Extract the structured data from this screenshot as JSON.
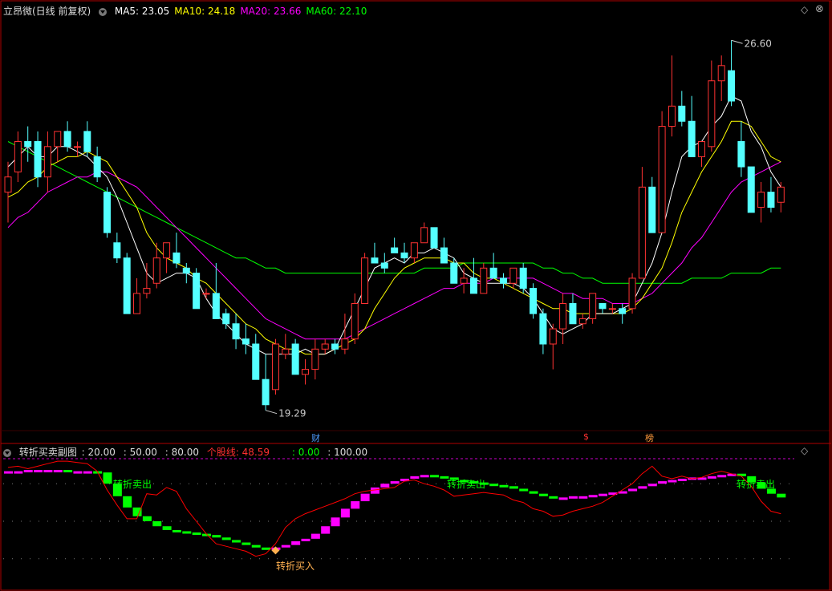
{
  "main_panel": {
    "title": "立昂微(日线 前复权)",
    "ma_legend": [
      {
        "label": "MA5: 23.05",
        "color": "#ffffff"
      },
      {
        "label": "MA10: 24.18",
        "color": "#ffff00"
      },
      {
        "label": "MA20: 23.66",
        "color": "#ff00ff"
      },
      {
        "label": "MA60: 22.10",
        "color": "#00ff00"
      }
    ],
    "high_label": "26.60",
    "low_label": "19.29",
    "event_tags": [
      {
        "text": "财",
        "color": "#4d9bff"
      },
      {
        "text": "$",
        "color": "#ff3030"
      },
      {
        "text": "榜",
        "color": "#ff9a3c"
      }
    ]
  },
  "sub_panel": {
    "title": "转折买卖副图",
    "params": [
      ": 20.00",
      ": 50.00",
      ": 80.00"
    ],
    "line_label": "个股线: 48.59",
    "extra_values": [
      ": 0.00",
      ": 100.00"
    ],
    "signals": [
      {
        "text": "转折卖出"
      },
      {
        "text": "转折买入"
      },
      {
        "text": "转折卖出"
      },
      {
        "text": "转折卖出"
      }
    ]
  },
  "colors": {
    "up": "#ff3232",
    "down": "#54ffff",
    "ma5": "#ffffff",
    "ma10": "#ffff00",
    "ma20": "#ff00ff",
    "ma60": "#00ff00",
    "bar_up": "#ff00ff",
    "bar_down": "#00ff00",
    "osc_line": "#ff0000",
    "border": "#b00000"
  },
  "chart_data": [
    {
      "type": "candlestick",
      "title": "立昂微(日线 前复权)",
      "x": [
        0,
        1,
        2,
        3,
        4,
        5,
        6,
        7,
        8,
        9,
        10,
        11,
        12,
        13,
        14,
        15,
        16,
        17,
        18,
        19,
        20,
        21,
        22,
        23,
        24,
        25,
        26,
        27,
        28,
        29,
        30,
        31,
        32,
        33,
        34,
        35,
        36,
        37,
        38,
        39,
        40,
        41,
        42,
        43,
        44,
        45,
        46,
        47,
        48,
        49,
        50,
        51,
        52,
        53,
        54,
        55,
        56,
        57,
        58,
        59,
        60,
        61,
        62,
        63,
        64,
        65,
        66,
        67,
        68,
        69,
        70,
        71,
        72,
        73,
        74,
        75,
        76,
        77,
        78
      ],
      "ohlc": [
        [
          23.6,
          24.2,
          23.0,
          23.9
        ],
        [
          24.0,
          24.8,
          23.8,
          24.6
        ],
        [
          24.6,
          24.9,
          24.2,
          24.5
        ],
        [
          24.6,
          24.8,
          23.7,
          23.9
        ],
        [
          23.9,
          24.8,
          23.6,
          24.5
        ],
        [
          24.5,
          24.8,
          24.2,
          24.8
        ],
        [
          24.8,
          25.0,
          24.4,
          24.5
        ],
        [
          24.5,
          24.6,
          24.3,
          24.5
        ],
        [
          24.8,
          25.0,
          24.3,
          24.4
        ],
        [
          24.3,
          24.5,
          23.8,
          23.9
        ],
        [
          23.6,
          23.7,
          22.7,
          22.8
        ],
        [
          22.6,
          22.8,
          22.2,
          22.3
        ],
        [
          22.3,
          22.4,
          21.2,
          21.2
        ],
        [
          21.2,
          21.9,
          21.2,
          21.6
        ],
        [
          21.6,
          22.2,
          21.5,
          21.7
        ],
        [
          21.8,
          22.6,
          21.7,
          22.3
        ],
        [
          22.3,
          22.6,
          22.0,
          22.6
        ],
        [
          22.4,
          22.8,
          22.1,
          22.2
        ],
        [
          22.1,
          22.2,
          21.8,
          22.0
        ],
        [
          22.0,
          22.1,
          21.3,
          21.3
        ],
        [
          21.6,
          21.7,
          21.5,
          21.6
        ],
        [
          21.6,
          22.2,
          21.5,
          21.1
        ],
        [
          21.2,
          21.3,
          20.9,
          21.0
        ],
        [
          21.0,
          21.2,
          20.5,
          20.7
        ],
        [
          20.7,
          21.0,
          20.4,
          20.6
        ],
        [
          20.6,
          20.8,
          20.1,
          19.9
        ],
        [
          19.9,
          20.4,
          19.29,
          19.4
        ],
        [
          19.7,
          20.7,
          19.6,
          20.6
        ],
        [
          20.4,
          20.8,
          20.3,
          20.5
        ],
        [
          20.6,
          20.7,
          20.0,
          20.0
        ],
        [
          20.0,
          20.3,
          19.8,
          20.1
        ],
        [
          20.1,
          20.7,
          19.9,
          20.5
        ],
        [
          20.5,
          20.7,
          20.4,
          20.6
        ],
        [
          20.6,
          20.7,
          20.4,
          20.5
        ],
        [
          20.5,
          21.2,
          20.4,
          20.7
        ],
        [
          20.7,
          21.6,
          20.6,
          21.4
        ],
        [
          21.4,
          22.4,
          21.4,
          22.3
        ],
        [
          22.3,
          22.6,
          22.2,
          22.2
        ],
        [
          22.2,
          22.4,
          22.0,
          22.1
        ],
        [
          22.5,
          22.7,
          22.4,
          22.4
        ],
        [
          22.4,
          22.6,
          22.2,
          22.3
        ],
        [
          22.3,
          22.6,
          22.2,
          22.6
        ],
        [
          22.6,
          23.0,
          22.6,
          22.9
        ],
        [
          22.9,
          22.9,
          22.5,
          22.5
        ],
        [
          22.5,
          22.7,
          22.2,
          22.2
        ],
        [
          22.2,
          22.3,
          21.8,
          21.8
        ],
        [
          21.8,
          22.1,
          21.6,
          21.9
        ],
        [
          21.9,
          22.3,
          21.7,
          21.6
        ],
        [
          21.6,
          22.2,
          21.6,
          22.1
        ],
        [
          22.1,
          22.4,
          21.9,
          21.9
        ],
        [
          21.9,
          22.0,
          21.7,
          21.8
        ],
        [
          21.8,
          22.0,
          21.7,
          22.1
        ],
        [
          22.1,
          22.2,
          21.6,
          21.7
        ],
        [
          21.7,
          21.8,
          21.1,
          21.2
        ],
        [
          21.2,
          21.3,
          20.4,
          20.6
        ],
        [
          20.6,
          21.0,
          20.1,
          20.9
        ],
        [
          20.9,
          21.6,
          20.6,
          21.4
        ],
        [
          21.4,
          21.6,
          21.0,
          21.0
        ],
        [
          21.0,
          21.2,
          20.9,
          21.1
        ],
        [
          21.1,
          21.6,
          21.0,
          21.6
        ],
        [
          21.4,
          21.4,
          21.2,
          21.3
        ],
        [
          21.3,
          21.4,
          21.2,
          21.3
        ],
        [
          21.3,
          21.4,
          21.0,
          21.2
        ],
        [
          21.3,
          22.0,
          21.2,
          21.9
        ],
        [
          21.9,
          24.1,
          21.9,
          23.7
        ],
        [
          23.7,
          23.9,
          22.8,
          22.8
        ],
        [
          22.8,
          25.2,
          22.8,
          24.9
        ],
        [
          24.9,
          26.3,
          24.7,
          25.3
        ],
        [
          25.3,
          25.6,
          24.9,
          25.0
        ],
        [
          25.0,
          25.5,
          24.3,
          24.3
        ],
        [
          24.3,
          24.6,
          24.1,
          24.6
        ],
        [
          24.5,
          26.2,
          24.4,
          25.8
        ],
        [
          25.8,
          26.3,
          25.4,
          26.1
        ],
        [
          26.0,
          26.6,
          25.3,
          25.4
        ],
        [
          24.6,
          25.0,
          23.9,
          24.1
        ],
        [
          24.1,
          24.1,
          23.2,
          23.2
        ],
        [
          23.3,
          23.8,
          23.0,
          23.6
        ],
        [
          23.6,
          23.9,
          23.2,
          23.3
        ],
        [
          23.4,
          23.8,
          23.2,
          23.7
        ]
      ],
      "ma5": [
        24.1,
        24.3,
        24.5,
        24.3,
        24.3,
        24.5,
        24.5,
        24.4,
        24.3,
        24.1,
        23.9,
        23.5,
        23.0,
        22.5,
        22.0,
        21.8,
        21.9,
        22.0,
        22.0,
        21.9,
        21.5,
        21.2,
        21.0,
        20.8,
        20.6,
        20.5,
        20.4,
        20.4,
        20.4,
        20.4,
        20.5,
        20.4,
        20.4,
        20.5,
        20.9,
        21.3,
        21.7,
        22.1,
        22.2,
        22.3,
        22.2,
        22.4,
        22.4,
        22.5,
        22.4,
        22.3,
        22.0,
        21.9,
        21.8,
        21.8,
        21.8,
        21.8,
        21.7,
        21.5,
        21.2,
        20.9,
        20.8,
        20.9,
        21.0,
        21.2,
        21.2,
        21.2,
        21.3,
        21.4,
        21.8,
        22.2,
        22.8,
        23.6,
        24.3,
        24.5,
        24.6,
        24.9,
        25.1,
        25.5,
        25.4,
        24.8,
        24.5,
        24.0,
        23.7
      ],
      "ma10": [
        23.5,
        23.6,
        23.8,
        23.9,
        24.1,
        24.2,
        24.3,
        24.3,
        24.4,
        24.3,
        24.2,
        23.9,
        23.6,
        23.3,
        22.8,
        22.5,
        22.3,
        22.2,
        22.1,
        21.9,
        21.8,
        21.6,
        21.4,
        21.2,
        21.0,
        20.9,
        20.7,
        20.6,
        20.5,
        20.5,
        20.4,
        20.4,
        20.4,
        20.5,
        20.6,
        20.7,
        20.9,
        21.3,
        21.6,
        21.9,
        22.1,
        22.2,
        22.3,
        22.3,
        22.3,
        22.2,
        22.2,
        22.0,
        21.9,
        21.9,
        21.8,
        21.7,
        21.6,
        21.5,
        21.4,
        21.3,
        21.3,
        21.2,
        21.2,
        21.2,
        21.2,
        21.2,
        21.2,
        21.3,
        21.5,
        21.8,
        22.1,
        22.6,
        23.2,
        23.6,
        24.0,
        24.3,
        24.6,
        25.0,
        25.0,
        24.9,
        24.6,
        24.3,
        24.2
      ],
      "ma20": [
        22.9,
        23.1,
        23.2,
        23.4,
        23.6,
        23.7,
        23.8,
        23.9,
        23.9,
        24.0,
        24.0,
        23.9,
        23.8,
        23.7,
        23.5,
        23.3,
        23.1,
        22.9,
        22.7,
        22.5,
        22.3,
        22.1,
        21.9,
        21.7,
        21.5,
        21.3,
        21.1,
        21.0,
        20.9,
        20.8,
        20.7,
        20.7,
        20.7,
        20.7,
        20.7,
        20.8,
        20.9,
        21.0,
        21.1,
        21.2,
        21.3,
        21.4,
        21.5,
        21.6,
        21.7,
        21.7,
        21.8,
        21.8,
        21.8,
        21.9,
        21.9,
        21.9,
        21.9,
        21.9,
        21.8,
        21.7,
        21.6,
        21.6,
        21.5,
        21.5,
        21.5,
        21.4,
        21.4,
        21.4,
        21.5,
        21.6,
        21.8,
        22.0,
        22.2,
        22.5,
        22.7,
        23.0,
        23.3,
        23.6,
        23.8,
        23.9,
        24.0,
        24.1,
        24.2
      ],
      "ma60": [
        24.6,
        24.5,
        24.4,
        24.3,
        24.2,
        24.1,
        24.0,
        23.9,
        23.8,
        23.7,
        23.6,
        23.5,
        23.4,
        23.3,
        23.2,
        23.1,
        23.0,
        22.9,
        22.8,
        22.7,
        22.6,
        22.5,
        22.4,
        22.3,
        22.3,
        22.2,
        22.1,
        22.1,
        22.0,
        22.0,
        22.0,
        22.0,
        22.0,
        22.0,
        22.0,
        22.0,
        22.0,
        22.0,
        22.0,
        22.0,
        22.0,
        22.0,
        22.1,
        22.1,
        22.1,
        22.1,
        22.2,
        22.2,
        22.2,
        22.2,
        22.2,
        22.2,
        22.2,
        22.2,
        22.1,
        22.1,
        22.0,
        22.0,
        21.9,
        21.9,
        21.8,
        21.8,
        21.8,
        21.8,
        21.8,
        21.8,
        21.8,
        21.8,
        21.8,
        21.9,
        21.9,
        21.9,
        21.9,
        22.0,
        22.0,
        22.0,
        22.0,
        22.1,
        22.1
      ],
      "ylim": [
        19.0,
        27.0
      ],
      "annotations": [
        "26.60",
        "19.29"
      ]
    },
    {
      "type": "bar",
      "title": "转折买卖副图",
      "x": [
        0,
        1,
        2,
        3,
        4,
        5,
        6,
        7,
        8,
        9,
        10,
        11,
        12,
        13,
        14,
        15,
        16,
        17,
        18,
        19,
        20,
        21,
        22,
        23,
        24,
        25,
        26,
        27,
        28,
        29,
        30,
        31,
        32,
        33,
        34,
        35,
        36,
        37,
        38,
        39,
        40,
        41,
        42,
        43,
        44,
        45,
        46,
        47,
        48,
        49,
        50,
        51,
        52,
        53,
        54,
        55,
        56,
        57,
        58,
        59,
        60,
        61,
        62,
        63,
        64,
        65,
        66,
        67,
        68,
        69,
        70,
        71,
        72,
        73,
        74,
        75,
        76,
        77,
        78
      ],
      "values": [
        90,
        90,
        91,
        91,
        91,
        91,
        90,
        90,
        90,
        89,
        80,
        70,
        61,
        54,
        50,
        46,
        43,
        42,
        41,
        40,
        39,
        37,
        35,
        33,
        31,
        29,
        28,
        29,
        31,
        34,
        36,
        40,
        46,
        53,
        60,
        66,
        72,
        77,
        80,
        82,
        84,
        86,
        87,
        86,
        85,
        83,
        82,
        81,
        80,
        79,
        78,
        76,
        74,
        72,
        70,
        69,
        69,
        70,
        70,
        71,
        72,
        73,
        74,
        76,
        78,
        80,
        82,
        83,
        84,
        85,
        85,
        86,
        87,
        88,
        86,
        81,
        76,
        72,
        69
      ],
      "colors_by_direction": "up=magenta, down=green",
      "line_name": "个股线",
      "line": [
        93,
        94,
        92,
        94,
        96,
        98,
        98,
        97,
        96,
        90,
        75,
        63,
        52,
        52,
        72,
        71,
        77,
        74,
        60,
        50,
        40,
        32,
        30,
        28,
        26,
        22,
        24,
        32,
        45,
        52,
        56,
        59,
        62,
        65,
        68,
        72,
        74,
        75,
        76,
        77,
        82,
        83,
        80,
        78,
        75,
        70,
        71,
        72,
        73,
        72,
        71,
        67,
        65,
        60,
        58,
        54,
        55,
        58,
        60,
        62,
        65,
        70,
        75,
        80,
        88,
        94,
        86,
        84,
        86,
        84,
        85,
        88,
        90,
        88,
        86,
        78,
        66,
        58,
        56
      ],
      "reference_lines": [
        20,
        50,
        80,
        100
      ],
      "ylim": [
        0,
        100
      ]
    }
  ]
}
